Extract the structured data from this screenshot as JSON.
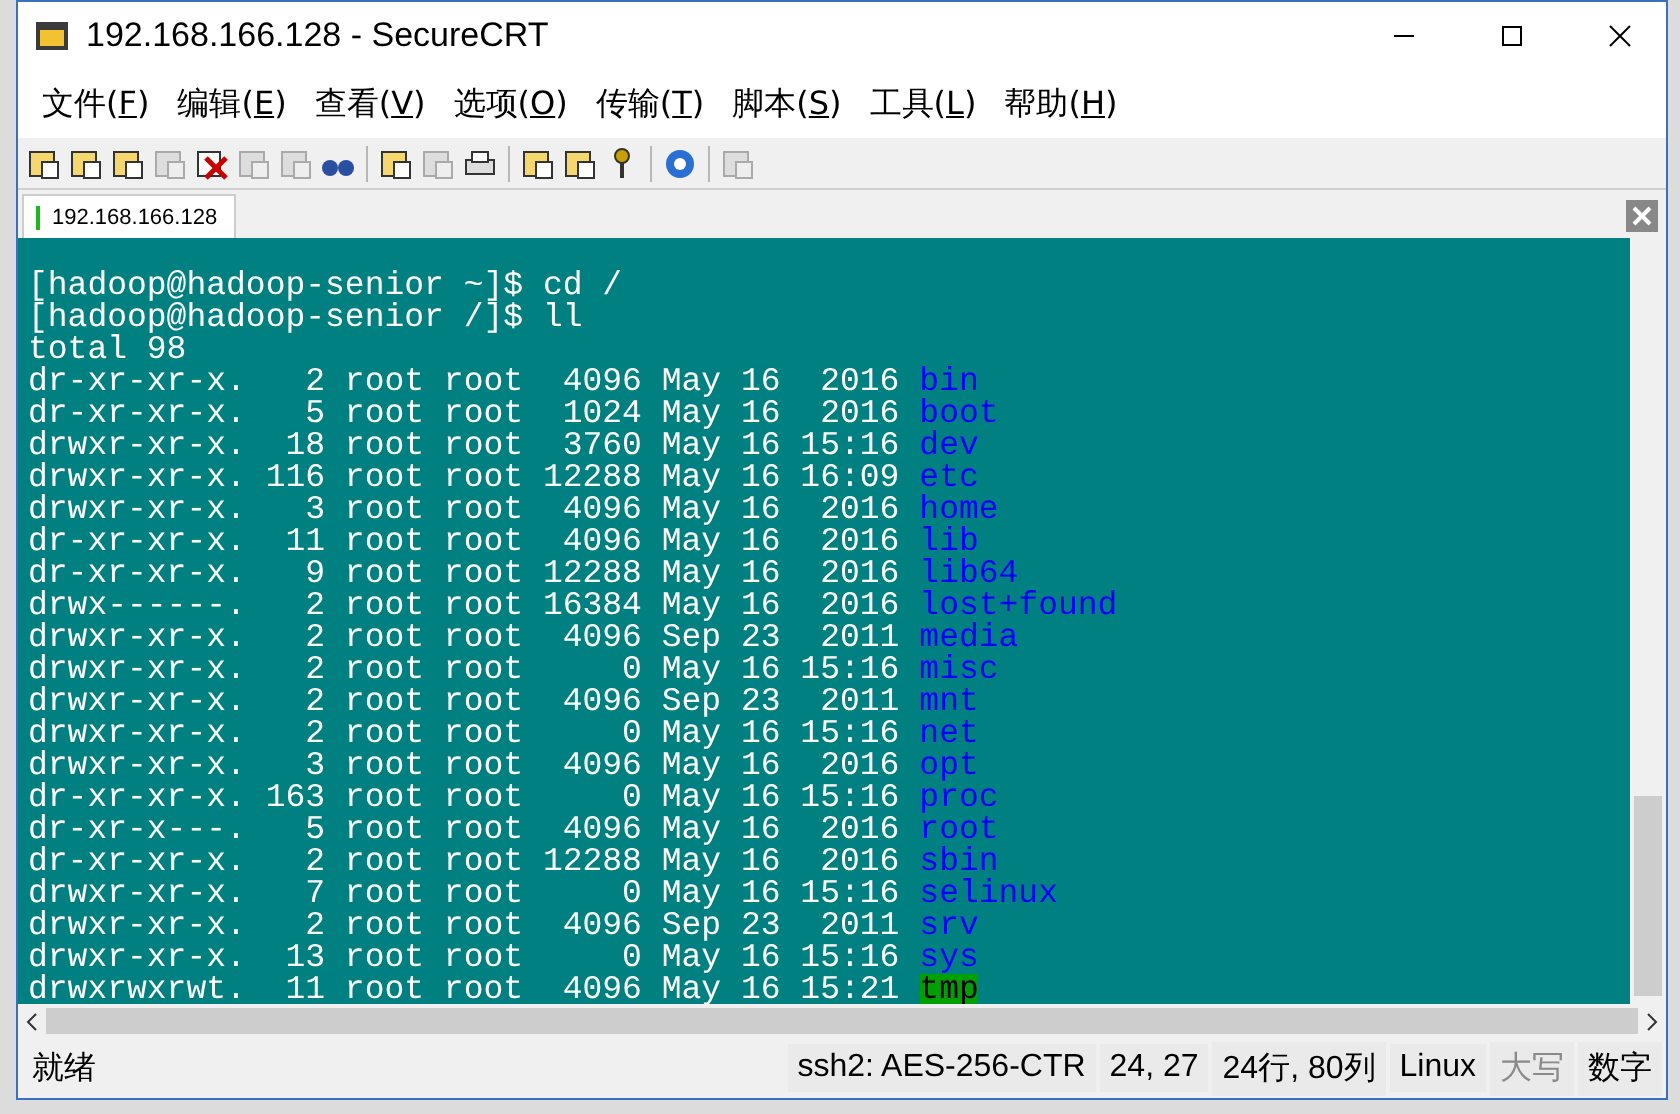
{
  "window": {
    "title": "192.168.166.128 - SecureCRT"
  },
  "menu": [
    {
      "label": "文件(F)"
    },
    {
      "label": "编辑(E)"
    },
    {
      "label": "查看(V)"
    },
    {
      "label": "选项(O)"
    },
    {
      "label": "传输(T)"
    },
    {
      "label": "脚本(S)"
    },
    {
      "label": "工具(L)"
    },
    {
      "label": "帮助(H)"
    }
  ],
  "toolbar": [
    {
      "disabled": false
    },
    {
      "disabled": false
    },
    {
      "disabled": false
    },
    {
      "disabled": true
    },
    {
      "disabled": false
    },
    {
      "disabled": true
    },
    {
      "disabled": true
    },
    {
      "disabled": false
    },
    {
      "disabled": false
    },
    {
      "disabled": true
    },
    {
      "disabled": false
    },
    {
      "disabled": false
    },
    {
      "disabled": false
    },
    {
      "disabled": false
    },
    {
      "disabled": false
    },
    {
      "disabled": true
    }
  ],
  "tabs": [
    {
      "label": "192.168.166.128",
      "selected": true
    }
  ],
  "terminal": {
    "lines": [
      {
        "kind": "text",
        "text": "[hadoop@hadoop-senior ~]$ cd /"
      },
      {
        "kind": "text",
        "text": "[hadoop@hadoop-senior /]$ ll"
      },
      {
        "kind": "text",
        "text": "total 98"
      },
      {
        "kind": "entry",
        "text": "dr-xr-xr-x.   2 root root  4096 May 16  2016",
        "name": "bin",
        "sticky": false
      },
      {
        "kind": "entry",
        "text": "dr-xr-xr-x.   5 root root  1024 May 16  2016",
        "name": "boot",
        "sticky": false
      },
      {
        "kind": "entry",
        "text": "drwxr-xr-x.  18 root root  3760 May 16 15:16",
        "name": "dev",
        "sticky": false
      },
      {
        "kind": "entry",
        "text": "drwxr-xr-x. 116 root root 12288 May 16 16:09",
        "name": "etc",
        "sticky": false
      },
      {
        "kind": "entry",
        "text": "drwxr-xr-x.   3 root root  4096 May 16  2016",
        "name": "home",
        "sticky": false
      },
      {
        "kind": "entry",
        "text": "dr-xr-xr-x.  11 root root  4096 May 16  2016",
        "name": "lib",
        "sticky": false
      },
      {
        "kind": "entry",
        "text": "dr-xr-xr-x.   9 root root 12288 May 16  2016",
        "name": "lib64",
        "sticky": false
      },
      {
        "kind": "entry",
        "text": "drwx------.   2 root root 16384 May 16  2016",
        "name": "lost+found",
        "sticky": false
      },
      {
        "kind": "entry",
        "text": "drwxr-xr-x.   2 root root  4096 Sep 23  2011",
        "name": "media",
        "sticky": false
      },
      {
        "kind": "entry",
        "text": "drwxr-xr-x.   2 root root     0 May 16 15:16",
        "name": "misc",
        "sticky": false
      },
      {
        "kind": "entry",
        "text": "drwxr-xr-x.   2 root root  4096 Sep 23  2011",
        "name": "mnt",
        "sticky": false
      },
      {
        "kind": "entry",
        "text": "drwxr-xr-x.   2 root root     0 May 16 15:16",
        "name": "net",
        "sticky": false
      },
      {
        "kind": "entry",
        "text": "drwxr-xr-x.   3 root root  4096 May 16  2016",
        "name": "opt",
        "sticky": false
      },
      {
        "kind": "entry",
        "text": "dr-xr-xr-x. 163 root root     0 May 16 15:16",
        "name": "proc",
        "sticky": false
      },
      {
        "kind": "entry",
        "text": "dr-xr-x---.   5 root root  4096 May 16  2016",
        "name": "root",
        "sticky": false
      },
      {
        "kind": "entry",
        "text": "dr-xr-xr-x.   2 root root 12288 May 16  2016",
        "name": "sbin",
        "sticky": false
      },
      {
        "kind": "entry",
        "text": "drwxr-xr-x.   7 root root     0 May 16 15:16",
        "name": "selinux",
        "sticky": false
      },
      {
        "kind": "entry",
        "text": "drwxr-xr-x.   2 root root  4096 Sep 23  2011",
        "name": "srv",
        "sticky": false
      },
      {
        "kind": "entry",
        "text": "drwxr-xr-x.  13 root root     0 May 16 15:16",
        "name": "sys",
        "sticky": false
      },
      {
        "kind": "entry",
        "text": "drwxrwxrwt.  11 root root  4096 May 16 15:21",
        "name": "tmp",
        "sticky": true
      }
    ]
  },
  "status_bar": [
    {
      "text": "就绪",
      "disabled": false
    },
    {
      "text": "ssh2: AES-256-CTR",
      "disabled": false
    },
    {
      "text": "24,  27",
      "disabled": false
    },
    {
      "text": "24行, 80列",
      "disabled": false
    },
    {
      "text": "Linux",
      "disabled": false
    },
    {
      "text": "大写",
      "disabled": true
    },
    {
      "text": "数字",
      "disabled": false
    }
  ]
}
